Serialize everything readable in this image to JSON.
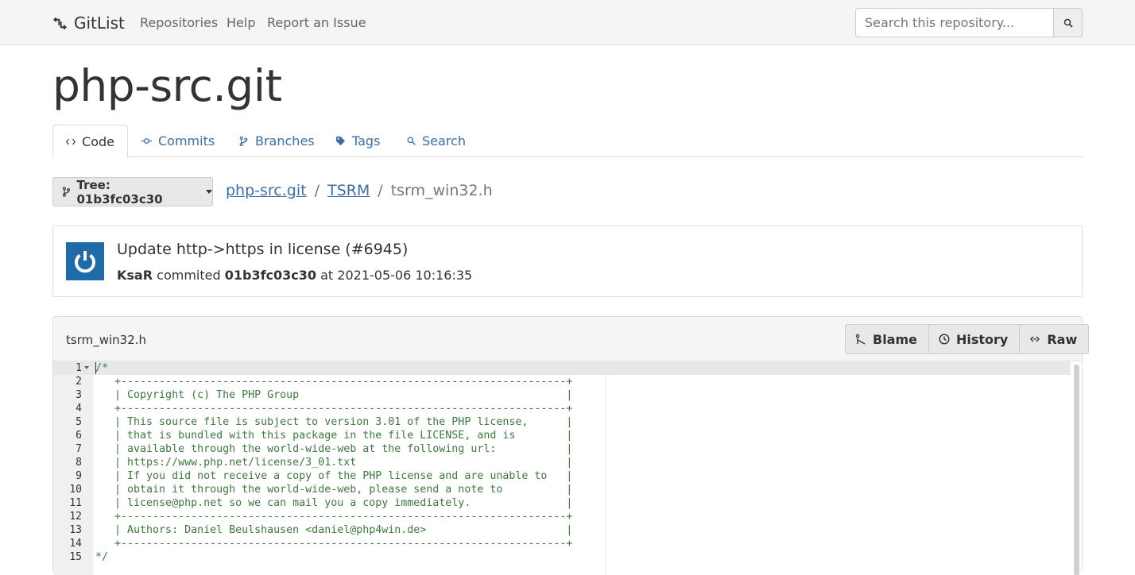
{
  "navbar": {
    "brand": "GitList",
    "links": [
      "Repositories",
      "Help",
      "Report an Issue"
    ],
    "search_placeholder": "Search this repository..."
  },
  "repo": {
    "title": "php-src.git"
  },
  "tabs": [
    {
      "label": "Code",
      "icon": "code-icon",
      "active": true
    },
    {
      "label": "Commits",
      "icon": "commit-icon",
      "active": false
    },
    {
      "label": "Branches",
      "icon": "branch-icon",
      "active": false
    },
    {
      "label": "Tags",
      "icon": "tag-icon",
      "active": false
    },
    {
      "label": "Search",
      "icon": "search-icon",
      "active": false
    }
  ],
  "tree": {
    "label": "Tree: 01b3fc03c30"
  },
  "breadcrumb": {
    "repo": "php-src.git",
    "dir": "TSRM",
    "file": "tsrm_win32.h",
    "separator": "/"
  },
  "commit": {
    "message": "Update http->https in license (#6945)",
    "author": "KsaR",
    "verb": "commited",
    "hash": "01b3fc03c30",
    "at": "at",
    "date": "2021-05-06 10:16:35"
  },
  "file": {
    "name": "tsrm_win32.h",
    "buttons": [
      "Blame",
      "History",
      "Raw"
    ]
  },
  "code": {
    "line_numbers": [
      "1",
      "2",
      "3",
      "4",
      "5",
      "6",
      "7",
      "8",
      "9",
      "10",
      "11",
      "12",
      "13",
      "14",
      "15"
    ],
    "lines": [
      "/*",
      "   +----------------------------------------------------------------------+",
      "   | Copyright (c) The PHP Group                                          |",
      "   +----------------------------------------------------------------------+",
      "   | This source file is subject to version 3.01 of the PHP license,      |",
      "   | that is bundled with this package in the file LICENSE, and is        |",
      "   | available through the world-wide-web at the following url:           |",
      "   | https://www.php.net/license/3_01.txt                                 |",
      "   | If you did not receive a copy of the PHP license and are unable to   |",
      "   | obtain it through the world-wide-web, please send a note to          |",
      "   | license@php.net so we can mail you a copy immediately.               |",
      "   +----------------------------------------------------------------------+",
      "   | Authors: Daniel Beulshausen <daniel@php4win.de>                      |",
      "   +----------------------------------------------------------------------+",
      "*/"
    ]
  },
  "colors": {
    "link": "#3b6ea8",
    "comment": "#3d7a3d",
    "avatar": "#1f6aa8"
  }
}
